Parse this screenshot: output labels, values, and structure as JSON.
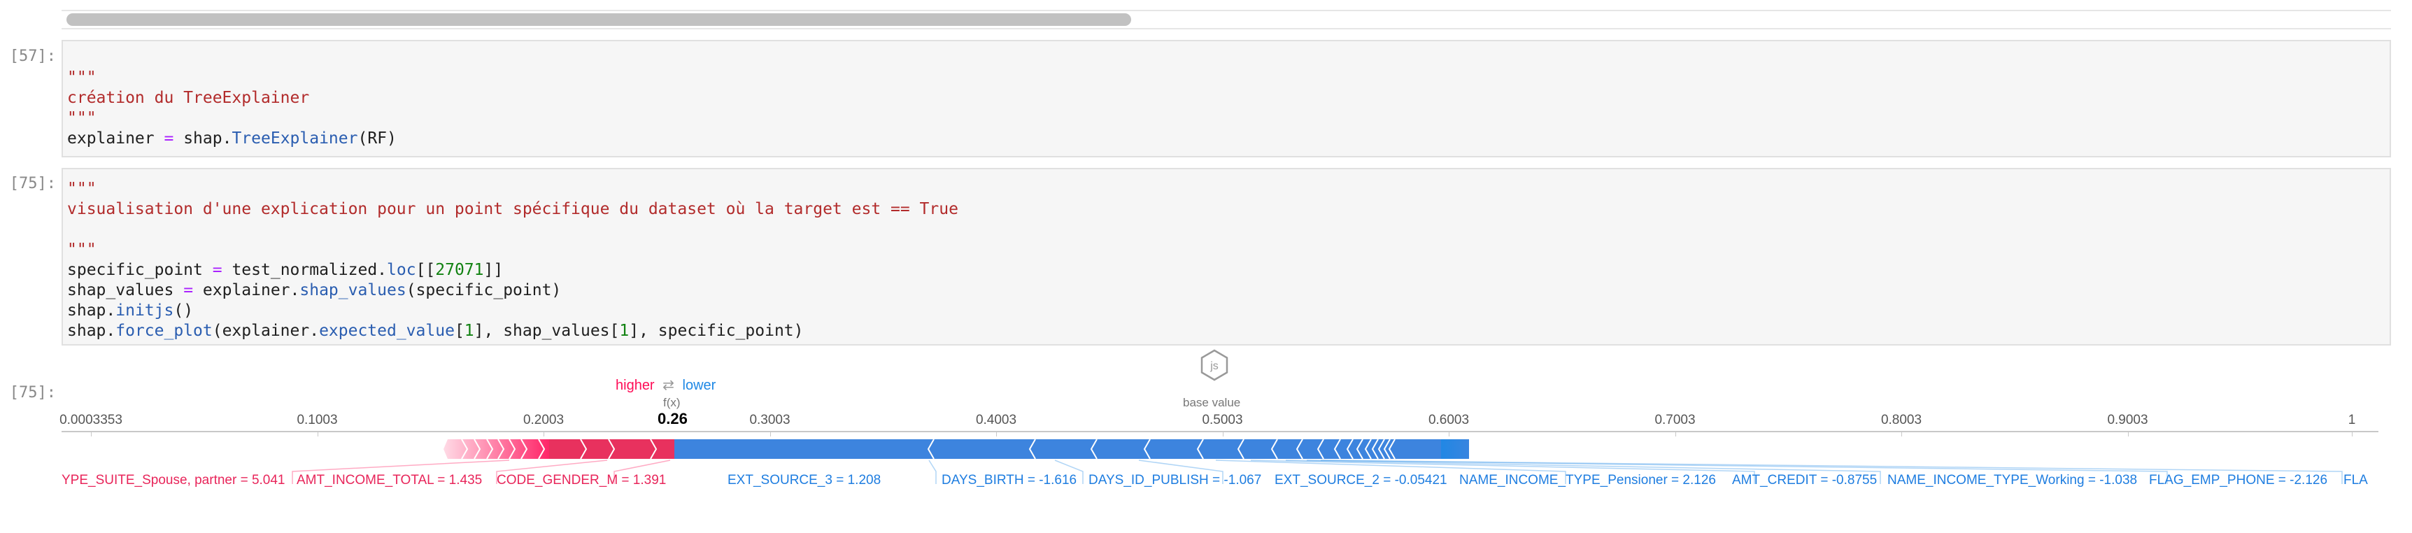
{
  "cells": [
    {
      "prompt": "[57]:",
      "lines": [
        "\"\"\"",
        "création du TreeExplainer",
        "\"\"\""
      ],
      "code": {
        "var": "explainer",
        "eq": "=",
        "mod": "shap.",
        "fn": "TreeExplainer",
        "args": "(RF)"
      }
    },
    {
      "prompt": "[75]:",
      "docstring": [
        "\"\"\"",
        "visualisation d'une explication pour un point spécifique du dataset où la target est == True",
        "",
        "\"\"\""
      ],
      "line1": {
        "var": "specific_point",
        "eq": "=",
        "obj": "test_normalized.",
        "attr": "loc",
        "open": "[[",
        "num": "27071",
        "close": "]]"
      },
      "line2": {
        "var": "shap_values",
        "eq": "=",
        "obj": "explainer.",
        "attr": "shap_values",
        "args": "(specific_point)"
      },
      "line3": {
        "obj": "shap.",
        "attr": "initjs",
        "args": "()"
      },
      "line4": {
        "obj": "shap.",
        "attr": "force_plot",
        "open": "(explainer.",
        "attr2": "expected_value",
        "idx1": "[",
        "n1": "1",
        "mid": "], shap_values[",
        "n2": "1",
        "end": "], specific_point)"
      }
    },
    {
      "prompt": "[75]:"
    }
  ],
  "js_badge": "js",
  "force_plot": {
    "legend": {
      "higher": "higher",
      "arrow": "⇄",
      "lower": "lower"
    },
    "fx_label": "f(x)",
    "fx_value": "0.26",
    "base_label": "base value",
    "ticks": [
      "0.0003353",
      "0.1003",
      "0.2003",
      "0.3003",
      "0.4003",
      "0.5003",
      "0.6003",
      "0.7003",
      "0.8003",
      "0.9003",
      "1"
    ],
    "positive_features": [
      "YPE_SUITE_Spouse, partner = 5.041",
      "AMT_INCOME_TOTAL = 1.435",
      "CODE_GENDER_M = 1.391"
    ],
    "negative_features": [
      "EXT_SOURCE_3 = 1.208",
      "DAYS_BIRTH = -1.616",
      "DAYS_ID_PUBLISH = -1.067",
      "EXT_SOURCE_2 = -0.05421",
      "NAME_INCOME_TYPE_Pensioner = 2.126",
      "AMT_CREDIT = -0.8755",
      "NAME_INCOME_TYPE_Working = -1.038",
      "FLAG_EMP_PHONE = -2.126",
      "FLA"
    ],
    "colors": {
      "positive": "#ff0d57",
      "negative": "#1e88e5"
    }
  }
}
